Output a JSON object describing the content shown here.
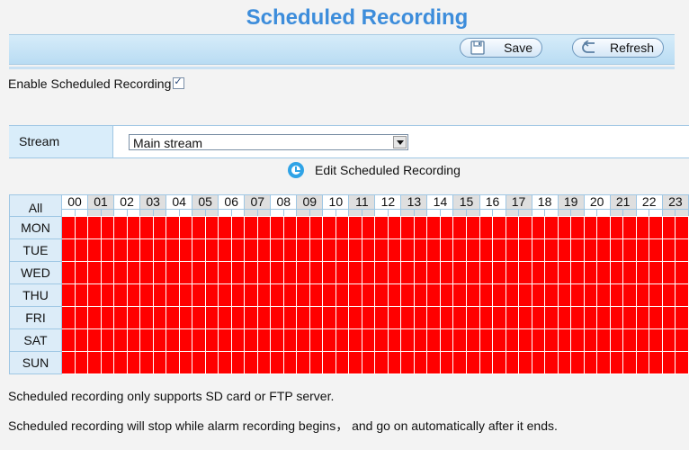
{
  "page_title": "Scheduled Recording",
  "toolbar": {
    "save_label": "Save",
    "refresh_label": "Refresh"
  },
  "enable": {
    "label": "Enable Scheduled Recording",
    "checked": true
  },
  "stream": {
    "label": "Stream",
    "selected": "Main stream"
  },
  "edit_label": "Edit Scheduled Recording",
  "schedule": {
    "all_label": "All",
    "hours": [
      "00",
      "01",
      "02",
      "03",
      "04",
      "05",
      "06",
      "07",
      "08",
      "09",
      "10",
      "11",
      "12",
      "13",
      "14",
      "15",
      "16",
      "17",
      "18",
      "19",
      "20",
      "21",
      "22",
      "23"
    ],
    "days": [
      "MON",
      "TUE",
      "WED",
      "THU",
      "FRI",
      "SAT",
      "SUN"
    ],
    "recording_fraction": 1.0,
    "active_color": "#ff0000"
  },
  "notes": [
    "Scheduled recording only supports SD card or FTP server.",
    "Scheduled recording will stop while alarm recording begins， and go on automatically after it ends."
  ]
}
